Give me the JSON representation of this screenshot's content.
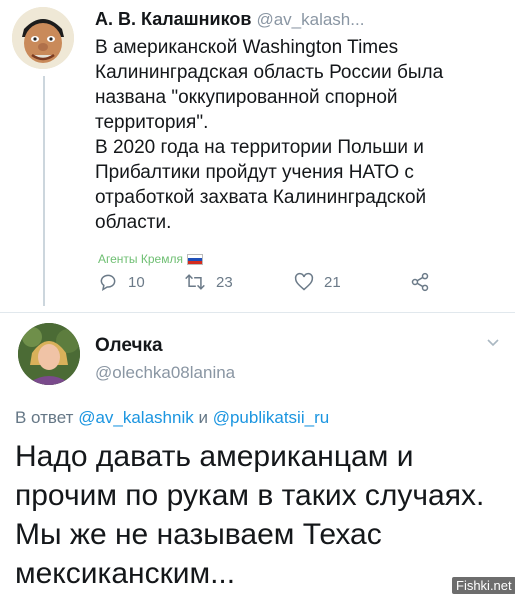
{
  "tweet1": {
    "author_name": "А. В. Калашников",
    "author_handle": "@av_kalash...",
    "body": [
      "В американской Washington Times Калининградская область России была названа \"оккупированной спорной территория\".",
      "В 2020 года на территории Польши и Прибалтики пройдут учения НАТО с отработкой захвата Калининградской области."
    ],
    "watermark": "Агенты Кремля",
    "replies_count": "10",
    "retweets_count": "23",
    "likes_count": "21",
    "icons": [
      "reply-icon",
      "retweet-icon",
      "like-icon",
      "share-icon"
    ]
  },
  "tweet2": {
    "author_name": "Олечка",
    "author_handle": "@olechka08lanina",
    "reply_prefix": "В ответ",
    "reply_handle_1": "@av_kalashnik",
    "reply_and": "и",
    "reply_handle_2": "@publikatsii_ru",
    "body": "Надо давать американцам и прочим по рукам в таких случаях. Мы же не называем Техас мексиканским..."
  },
  "site_watermark": "Fishki.net",
  "colors": {
    "link": "#1b95e0",
    "muted": "#657786",
    "watermark_green": "#6fbf73",
    "text": "#14171a"
  }
}
